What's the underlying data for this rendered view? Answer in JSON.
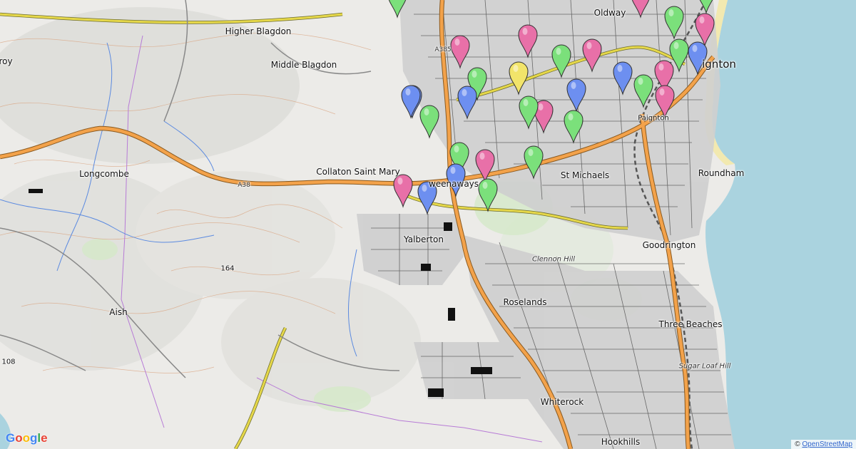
{
  "colors": {
    "sea": "#aad3df",
    "land": "#eeeeec",
    "green_pin": "#7be07b",
    "pink_pin": "#e870a8",
    "blue_pin": "#6d8ff0",
    "yellow_pin": "#f2e46a",
    "primary_road": "#f3a24a",
    "secondary_road": "#e6d84a",
    "beach": "#f2e9b0"
  },
  "places": [
    {
      "id": "oldway",
      "label": "Oldway",
      "kind": "normal"
    },
    {
      "id": "paignton",
      "label": "ignton",
      "kind": "town"
    },
    {
      "id": "higher-blagdon",
      "label": "Higher Blagdon",
      "kind": "normal"
    },
    {
      "id": "middle-blagdon",
      "label": "Middle Blagdon",
      "kind": "normal"
    },
    {
      "id": "roy",
      "label": "roy",
      "kind": "normal"
    },
    {
      "id": "longcombe",
      "label": "Longcombe",
      "kind": "normal"
    },
    {
      "id": "collaton",
      "label": "Collaton Saint Mary",
      "kind": "normal"
    },
    {
      "id": "tweenaways",
      "label": "weenaways",
      "kind": "normal"
    },
    {
      "id": "st-michaels",
      "label": "St Michaels",
      "kind": "normal"
    },
    {
      "id": "roundham",
      "label": "Roundham",
      "kind": "normal"
    },
    {
      "id": "goodrington",
      "label": "Goodrington",
      "kind": "normal"
    },
    {
      "id": "yalberton",
      "label": "Yalberton",
      "kind": "normal"
    },
    {
      "id": "clennon-hill",
      "label": "Clennon Hill",
      "kind": "hill"
    },
    {
      "id": "roselands",
      "label": "Roselands",
      "kind": "normal"
    },
    {
      "id": "three-beaches",
      "label": "Three Beaches",
      "kind": "normal"
    },
    {
      "id": "sugar-loaf-hill",
      "label": "Sugar Loaf Hill",
      "kind": "hill"
    },
    {
      "id": "whiterock",
      "label": "Whiterock",
      "kind": "normal"
    },
    {
      "id": "hookhills",
      "label": "Hookhills",
      "kind": "normal"
    },
    {
      "id": "aish",
      "label": "Aish",
      "kind": "normal"
    },
    {
      "id": "paignton-station",
      "label": "Paignton",
      "kind": "small"
    },
    {
      "id": "spot-164",
      "label": "164",
      "kind": "small"
    },
    {
      "id": "spot-108",
      "label": "108",
      "kind": "small"
    },
    {
      "id": "road-a385",
      "label": "A385",
      "kind": "road"
    },
    {
      "id": "road-a38",
      "label": "A38",
      "kind": "road"
    }
  ],
  "markers": [
    {
      "color": "green"
    },
    {
      "color": "pink"
    },
    {
      "color": "green"
    },
    {
      "color": "pink"
    },
    {
      "color": "green"
    },
    {
      "color": "pink"
    },
    {
      "color": "pink"
    },
    {
      "color": "green"
    },
    {
      "color": "pink"
    },
    {
      "color": "green"
    },
    {
      "color": "blue"
    },
    {
      "color": "yellow"
    },
    {
      "color": "green"
    },
    {
      "color": "blue"
    },
    {
      "color": "pink"
    },
    {
      "color": "blue"
    },
    {
      "color": "green"
    },
    {
      "color": "pink"
    },
    {
      "color": "blue"
    },
    {
      "color": "blue"
    },
    {
      "color": "green"
    },
    {
      "color": "pink"
    },
    {
      "color": "blue"
    },
    {
      "color": "green"
    },
    {
      "color": "green"
    },
    {
      "color": "pink"
    },
    {
      "color": "green"
    },
    {
      "color": "green"
    },
    {
      "color": "pink"
    },
    {
      "color": "blue"
    },
    {
      "color": "blue"
    },
    {
      "color": "green"
    }
  ],
  "branding": {
    "logo_text": "Google",
    "attribution_prefix": "© ",
    "attribution_link": "OpenStreetMap"
  }
}
